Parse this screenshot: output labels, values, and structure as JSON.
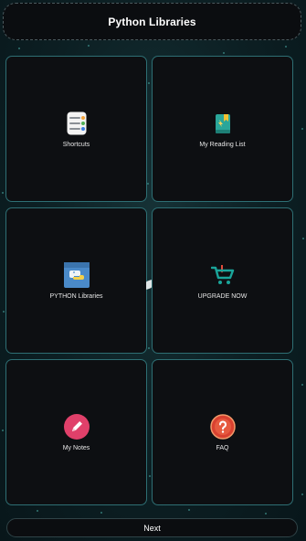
{
  "header": {
    "title": "Python Libraries"
  },
  "tiles": [
    {
      "label": "Shortcuts",
      "icon": "notes-list-icon"
    },
    {
      "label": "My Reading List",
      "icon": "book-icon"
    },
    {
      "label": "PYTHON Libraries",
      "icon": "python-book-icon"
    },
    {
      "label": "UPGRADE NOW",
      "icon": "cart-download-icon"
    },
    {
      "label": "My Notes",
      "icon": "pencil-icon"
    },
    {
      "label": "FAQ",
      "icon": "question-icon"
    }
  ],
  "footer": {
    "next_label": "Next"
  },
  "colors": {
    "accent_teal": "#2e6f74",
    "tile_bg": "#0d0f12",
    "cart_teal": "#1aa59a",
    "download_red": "#e34b3b",
    "notes_pink": "#e0406a",
    "faq_red": "#d94130"
  }
}
